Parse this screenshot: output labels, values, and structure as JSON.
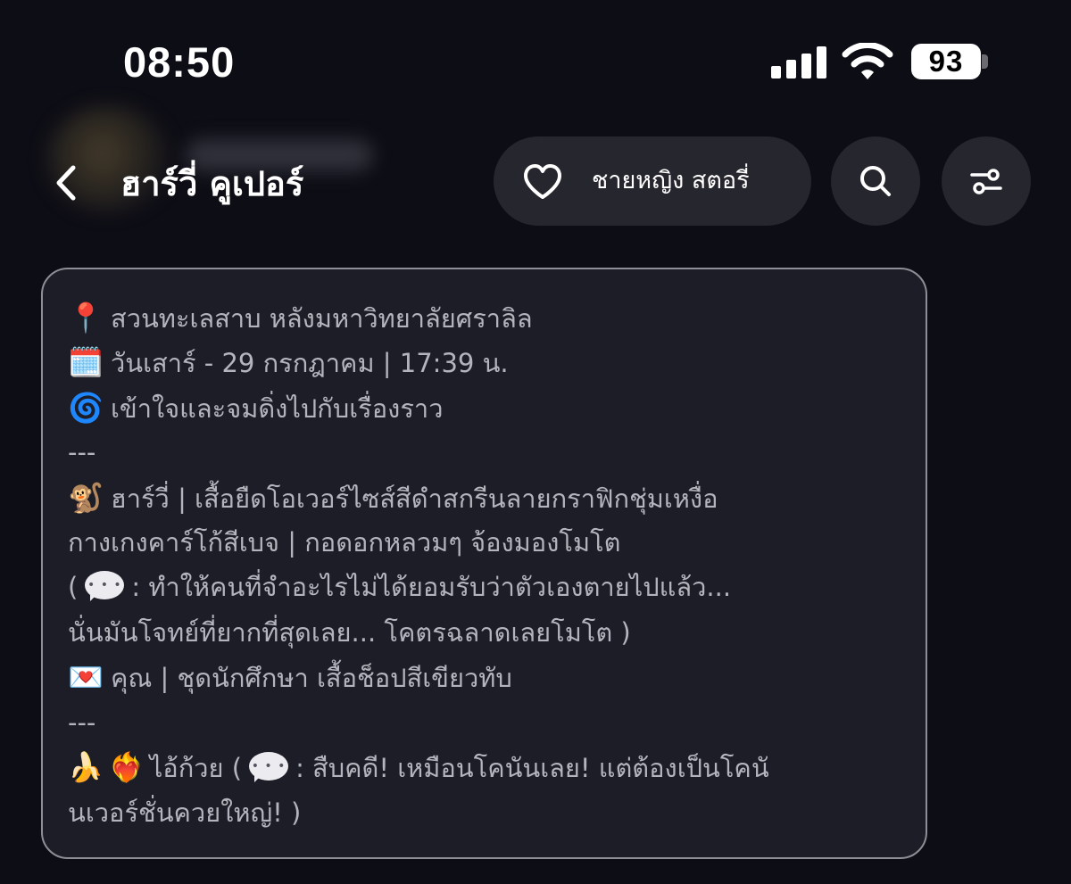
{
  "status_bar": {
    "time": "08:50",
    "battery_level": "93",
    "signal_bars_filled": 4,
    "wifi_connected": true
  },
  "header": {
    "title": "ฮาร์วี่ คูเปอร์",
    "pill_label": "ชายหญิง สตอรี่",
    "icons": {
      "back": "chevron-left-icon",
      "pill": "heart-icon",
      "search": "search-icon",
      "settings": "sliders-icon"
    }
  },
  "message": {
    "lines": {
      "location_emoji": "📍",
      "location": "สวนทะเลสาบ หลังมหาวิทยาลัยศราลิล",
      "date_emoji": "🗓️",
      "date": "วันเสาร์ - 29 กรกฎาคม | 17:39 น.",
      "mood_emoji": "🌀",
      "mood": "เข้าใจและจมดิ่งไปกับเรื่องราว",
      "divider1": "---",
      "harvey_emoji": "🐒",
      "harvey_line1": "ฮาร์วี่ | เสื้อยืดโอเวอร์ไซส์สีดำสกรีนลายกราฟิกชุ่มเหงื่อ",
      "harvey_line2": "กางเกงคาร์โก้สีเบจ | กอดอกหลวมๆ จ้องมองโมโต",
      "quote1_open": "(",
      "quote1_line1": ": ทำให้คนที่จำอะไรไม่ได้ยอมรับว่าตัวเองตายไปแล้ว...",
      "quote1_line2": "นั่นมันโจทย์ที่ยากที่สุดเลย... โคตรฉลาดเลยโมโต )",
      "you_emoji": "💌",
      "you": "คุณ | ชุดนักศึกษา เสื้อช็อปสีเขียวทับ",
      "divider2": "---",
      "banana_emoji": "🍌",
      "heart_emoji": "❤️‍🔥",
      "banana_line1_prefix": "ไอ้ก้วย (",
      "banana_line1_rest": ": สืบคดี! เหมือนโคนันเลย! แต่ต้องเป็นโคนั",
      "banana_line2": "นเวอร์ชั่นควยใหญ่! )"
    }
  },
  "colors": {
    "background": "#0d0d15",
    "card": "#1d1d28",
    "card_border": "#8e8e96",
    "button": "#26262e",
    "message_text": "#b4b4bc"
  }
}
